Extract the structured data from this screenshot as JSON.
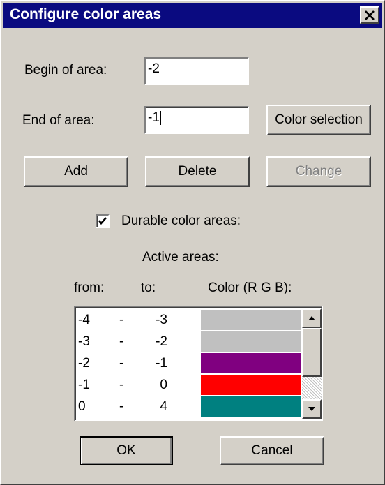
{
  "window": {
    "title": "Configure color areas",
    "close_symbol": "✕"
  },
  "form": {
    "begin_label": "Begin of area:",
    "begin_value": "-2",
    "end_label": "End of area:",
    "end_value": "-1",
    "color_selection_label": "Color selection"
  },
  "actions": {
    "add_label": "Add",
    "delete_label": "Delete",
    "change_label": "Change"
  },
  "durable": {
    "label": "Durable color areas:",
    "checked": true
  },
  "active": {
    "title": "Active areas:",
    "headers": {
      "from": "from:",
      "to": "to:",
      "color": "Color (R G B):"
    },
    "rows": [
      {
        "from": "-4",
        "dash": "-",
        "to": "-3",
        "color": "#c0c0c0"
      },
      {
        "from": "-3",
        "dash": "-",
        "to": "-2",
        "color": "#c0c0c0"
      },
      {
        "from": "-2",
        "dash": "-",
        "to": "-1",
        "color": "#800080"
      },
      {
        "from": "-1",
        "dash": "-",
        "to": "0",
        "color": "#ff0000"
      },
      {
        "from": "0",
        "dash": "-",
        "to": "4",
        "color": "#008080"
      }
    ]
  },
  "footer": {
    "ok_label": "OK",
    "cancel_label": "Cancel"
  },
  "colors": {
    "titlebar": "#0a0a80",
    "face": "#d4d0c8"
  }
}
